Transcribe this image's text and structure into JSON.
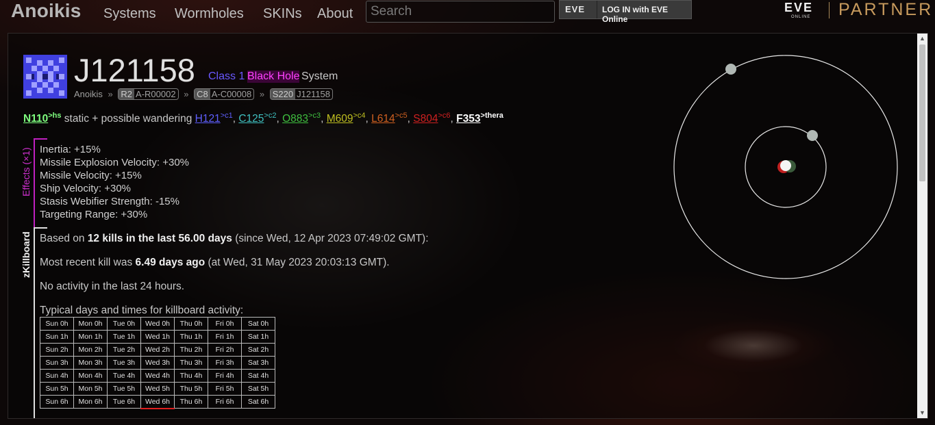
{
  "nav": {
    "brand": "Anoikis",
    "links": [
      "Systems",
      "Wormholes",
      "SKINs",
      "About"
    ],
    "search_placeholder": "Search",
    "login": {
      "logo": "EVE",
      "label": "LOG IN with EVE Online"
    },
    "eve_logo": "EVE",
    "eve_sub": "ONLINE",
    "partner": "PARTNER"
  },
  "system": {
    "name": "J121158",
    "class_label": "Class 1",
    "effect": "Black Hole",
    "type": "System",
    "breadcrumb": {
      "root": "Anoikis",
      "region_tag": "R2",
      "region": "A-R00002",
      "constellation_tag": "C8",
      "constellation": "A-C00008",
      "system_tag": "S220",
      "system": "J121158"
    }
  },
  "statics": {
    "static": {
      "code": "N110",
      "dest": ">hs",
      "color": "#7fff7f"
    },
    "middle_text": " static + possible wandering ",
    "wandering": [
      {
        "code": "H121",
        "dest": ">c1",
        "color": "#5f5fff"
      },
      {
        "code": "C125",
        "dest": ">c2",
        "color": "#3fc0c0"
      },
      {
        "code": "O883",
        "dest": ">c3",
        "color": "#3fbf3f"
      },
      {
        "code": "M609",
        "dest": ">c4",
        "color": "#bfbf20"
      },
      {
        "code": "L614",
        "dest": ">c5",
        "color": "#d06020"
      },
      {
        "code": "S804",
        "dest": ">c6",
        "color": "#d02020"
      },
      {
        "code": "F353",
        "dest": ">thera",
        "color": "#ffffff"
      }
    ]
  },
  "effects": {
    "label": "Effects (×1)",
    "items": [
      "Inertia: +15%",
      "Missile Explosion Velocity: +30%",
      "Missile Velocity: +15%",
      "Ship Velocity: +30%",
      "Stasis Webifier Strength: -15%",
      "Targeting Range: +30%"
    ]
  },
  "killboard": {
    "label": "zKillboard",
    "based_pre": "Based on ",
    "based_bold": "12 kills in the last 56.00 days",
    "based_post": " (since Wed, 12 Apr 2023 07:49:02 GMT):",
    "recent_pre": "Most recent kill was ",
    "recent_bold": "6.49 days ago",
    "recent_post": " (at Wed, 31 May 2023 20:03:13 GMT).",
    "activity": "No activity in the last 24 hours.",
    "typical": "Typical days and times for killboard activity:",
    "table": [
      [
        "Sun 0h",
        "Mon 0h",
        "Tue 0h",
        "Wed 0h",
        "Thu 0h",
        "Fri 0h",
        "Sat 0h"
      ],
      [
        "Sun 1h",
        "Mon 1h",
        "Tue 1h",
        "Wed 1h",
        "Thu 1h",
        "Fri 1h",
        "Sat 1h"
      ],
      [
        "Sun 2h",
        "Mon 2h",
        "Tue 2h",
        "Wed 2h",
        "Thu 2h",
        "Fri 2h",
        "Sat 2h"
      ],
      [
        "Sun 3h",
        "Mon 3h",
        "Tue 3h",
        "Wed 3h",
        "Thu 3h",
        "Fri 3h",
        "Sat 3h"
      ],
      [
        "Sun 4h",
        "Mon 4h",
        "Tue 4h",
        "Wed 4h",
        "Thu 4h",
        "Fri 4h",
        "Sat 4h"
      ],
      [
        "Sun 5h",
        "Mon 5h",
        "Tue 5h",
        "Wed 5h",
        "Thu 5h",
        "Fri 5h",
        "Sat 5h"
      ],
      [
        "Sun 6h",
        "Mon 6h",
        "Tue 6h",
        "Wed 6h",
        "Thu 6h",
        "Fri 6h",
        "Sat 6h"
      ]
    ],
    "highlight_cell": "Wed 6h"
  }
}
